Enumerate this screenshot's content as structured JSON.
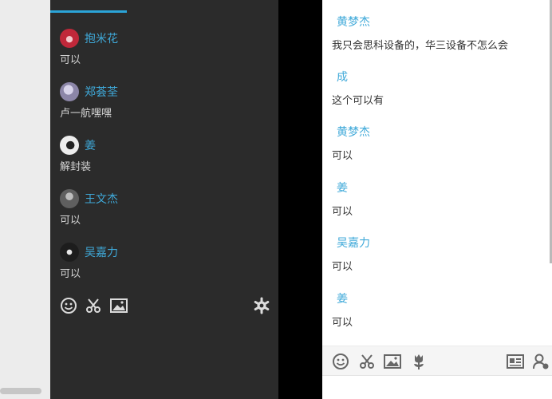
{
  "left_chat": {
    "messages": [
      {
        "name": "抱米花",
        "text": "可以",
        "avatar_color": "#c0283a"
      },
      {
        "name": "郑荟荃",
        "text": "卢一航嘿嘿",
        "avatar_color": "#8c86a8"
      },
      {
        "name": "姜",
        "text": "解封装",
        "avatar_color": "#ededed"
      },
      {
        "name": "王文杰",
        "text": "可以",
        "avatar_color": "#5f5f5f"
      },
      {
        "name": "吴嘉力",
        "text": "可以",
        "avatar_color": "#1d1d1d"
      }
    ],
    "toolbar_icons": [
      "emoji-icon",
      "scissors-icon",
      "image-icon",
      "gear-icon"
    ]
  },
  "right_chat": {
    "messages": [
      {
        "name": "黄梦杰",
        "text": "我只会思科设备的，华三设备不怎么会"
      },
      {
        "name": "成",
        "text": "这个可以有"
      },
      {
        "name": "黄梦杰",
        "text": "可以"
      },
      {
        "name": "姜",
        "text": "可以"
      },
      {
        "name": "吴嘉力",
        "text": "可以"
      },
      {
        "name": "姜",
        "text": "可以"
      }
    ],
    "toolbar_icons": [
      "emoji-icon",
      "scissors-icon",
      "image-icon",
      "flower-icon",
      "card-icon",
      "contact-icon"
    ]
  },
  "colors": {
    "accent": "#2ba4d8",
    "dark_bg": "#2b2b2b",
    "name_blue": "#3fa9d9"
  }
}
